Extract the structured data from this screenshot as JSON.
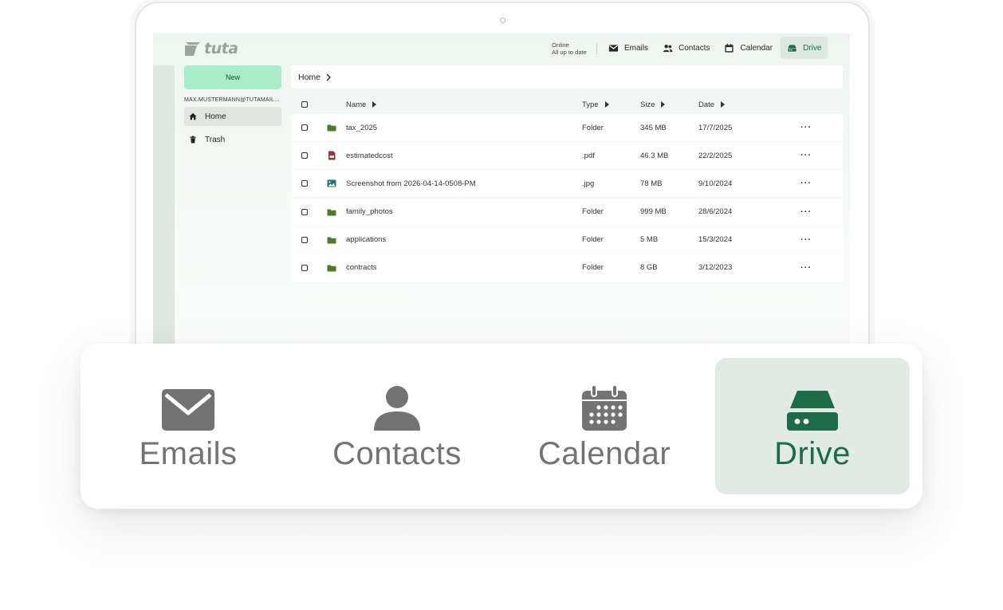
{
  "brand": {
    "name": "tuta",
    "logo_color": "#9aa39c",
    "accent": "#1e6b48",
    "new_button_color": "#a8ecc8"
  },
  "status": {
    "line1": "Online",
    "line2": "All up to date"
  },
  "topnav": [
    {
      "label": "Emails",
      "icon": "mail-icon"
    },
    {
      "label": "Contacts",
      "icon": "contacts-icon"
    },
    {
      "label": "Calendar",
      "icon": "calendar-icon"
    },
    {
      "label": "Drive",
      "icon": "drive-icon",
      "active": true
    }
  ],
  "sidebar": {
    "new_label": "New",
    "account": "MAX.MUSTERMANN@TUTAMAIL.COM",
    "items": [
      {
        "label": "Home",
        "icon": "home-icon",
        "active": true
      },
      {
        "label": "Trash",
        "icon": "trash-icon"
      }
    ]
  },
  "breadcrumb": {
    "home": "Home"
  },
  "table": {
    "headers": {
      "name": "Name",
      "type": "Type",
      "size": "Size",
      "date": "Date"
    },
    "rows": [
      {
        "name": "tax_2025",
        "type": "Folder",
        "size": "345 MB",
        "date": "17/7/2025",
        "icon": "folder-icon"
      },
      {
        "name": "estimatedcost",
        "type": ".pdf",
        "size": "46.3 MB",
        "date": "22/2/2025",
        "icon": "pdf-icon"
      },
      {
        "name": "Screenshot from 2026-04-14-0508-PM",
        "type": ".jpg",
        "size": "78 MB",
        "date": "9/10/2024",
        "icon": "image-icon"
      },
      {
        "name": "family_photos",
        "type": "Folder",
        "size": "999 MB",
        "date": "28/6/2024",
        "icon": "folder-icon"
      },
      {
        "name": "applications",
        "type": "Folder",
        "size": "5 MB",
        "date": "15/3/2024",
        "icon": "folder-icon"
      },
      {
        "name": "contracts",
        "type": "Folder",
        "size": "8 GB",
        "date": "3/12/2023",
        "icon": "folder-icon"
      }
    ],
    "actions_label": "···"
  },
  "bottom_nav": [
    {
      "label": "Emails",
      "icon": "mail-icon"
    },
    {
      "label": "Contacts",
      "icon": "person-icon"
    },
    {
      "label": "Calendar",
      "icon": "calendar-icon"
    },
    {
      "label": "Drive",
      "icon": "drive-icon",
      "active": true
    }
  ]
}
